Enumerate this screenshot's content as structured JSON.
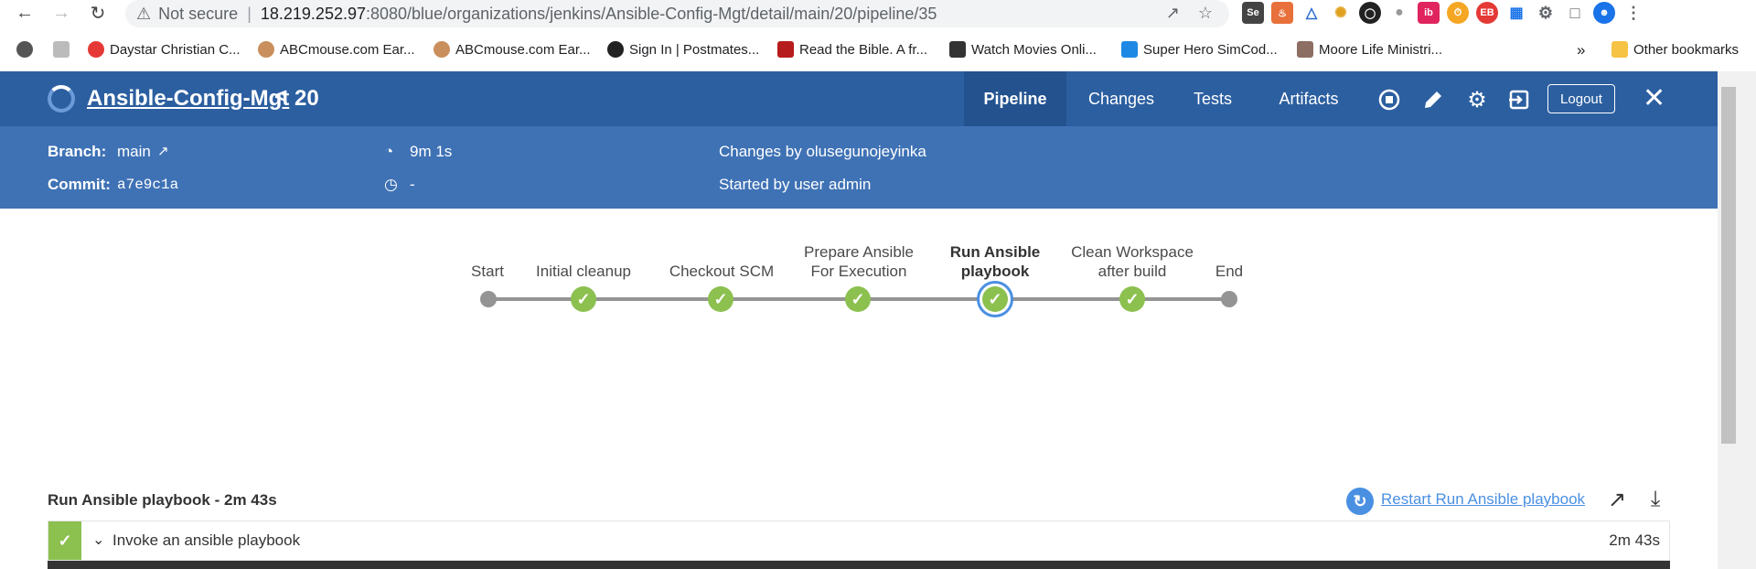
{
  "browser": {
    "not_secure": "Not secure",
    "url_host": "18.219.252.97",
    "url_path": ":8080/blue/organizations/jenkins/Ansible-Config-Mgt/detail/main/20/pipeline/35",
    "bookmarks": [
      "Daystar Christian C...",
      "ABCmouse.com Ear...",
      "ABCmouse.com Ear...",
      "Sign In | Postmates...",
      "Read the Bible. A fr...",
      "Watch Movies Onli...",
      "Super Hero SimCod...",
      "Moore Life Ministri..."
    ],
    "more_bookmarks": "»",
    "other_bookmarks": "Other bookmarks"
  },
  "header": {
    "pipeline_name": "Ansible-Config-Mgt",
    "back_glyph": "<",
    "run_number": "20",
    "tabs": [
      "Pipeline",
      "Changes",
      "Tests",
      "Artifacts"
    ],
    "active_tab": "Pipeline",
    "logout_label": "Logout"
  },
  "run_info": {
    "branch_label": "Branch:",
    "branch_value": "main",
    "commit_label": "Commit:",
    "commit_value": "a7e9c1a",
    "duration": "9m 1s",
    "finished": "-",
    "changes": "Changes by olusegunojeyinka",
    "started_by": "Started by user admin"
  },
  "pipeline": {
    "stages": [
      {
        "label": "Start",
        "status": "none"
      },
      {
        "label": "Initial cleanup",
        "status": "success"
      },
      {
        "label": "Checkout SCM",
        "status": "success"
      },
      {
        "label": "Prepare Ansible For Execution",
        "status": "success"
      },
      {
        "label": "Run Ansible playbook",
        "status": "success",
        "selected": true
      },
      {
        "label": "Clean Workspace after build",
        "status": "success"
      },
      {
        "label": "End",
        "status": "none"
      }
    ]
  },
  "stage_detail": {
    "title": "Run Ansible playbook - 2m 43s",
    "restart_label": "Restart Run Ansible playbook",
    "steps": [
      {
        "name": "Invoke an ansible playbook",
        "duration": "2m 43s",
        "status": "success"
      }
    ]
  },
  "colors": {
    "header_bg": "#2c5fa0",
    "subheader_bg": "#3f72b5",
    "success": "#8cc04f",
    "selected_ring": "#4a90e2",
    "link": "#4a90e2"
  }
}
